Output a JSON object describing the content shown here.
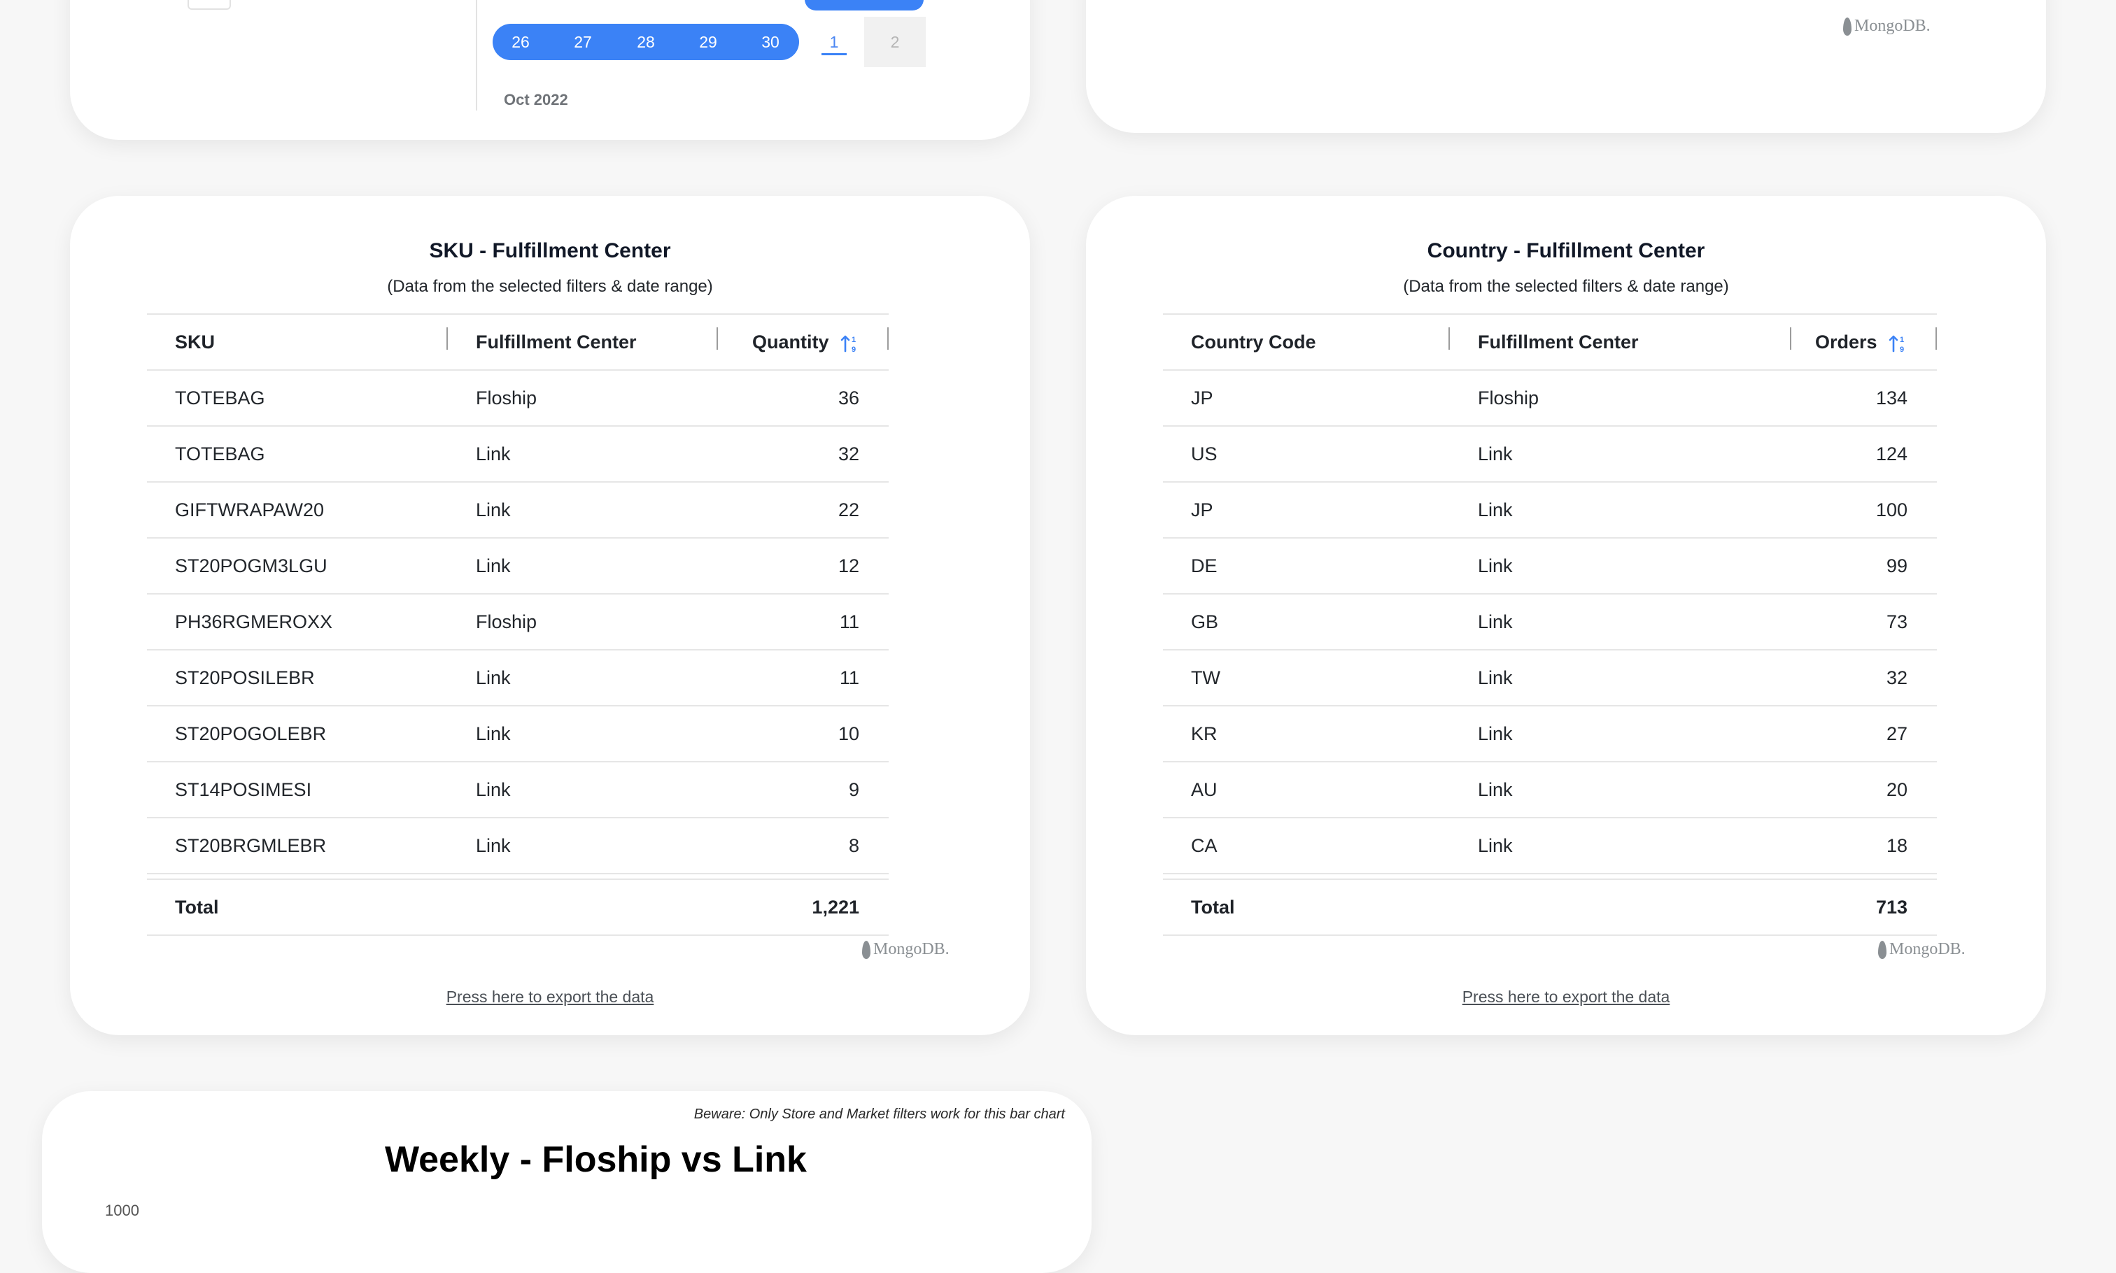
{
  "calendar": {
    "days": [
      "26",
      "27",
      "28",
      "29",
      "30"
    ],
    "next_days": [
      "1",
      "2"
    ],
    "month_label": "Oct 2022"
  },
  "brand": {
    "mongodb_label": "MongoDB."
  },
  "sku_table": {
    "title": "SKU - Fulfillment Center",
    "subtitle": "(Data from the selected filters & date range)",
    "headers": [
      "SKU",
      "Fulfillment Center",
      "Quantity"
    ],
    "rows": [
      [
        "TOTEBAG",
        "Floship",
        "36"
      ],
      [
        "TOTEBAG",
        "Link",
        "32"
      ],
      [
        "GIFTWRAPAW20",
        "Link",
        "22"
      ],
      [
        "ST20POGM3LGU",
        "Link",
        "12"
      ],
      [
        "PH36RGMEROXX",
        "Floship",
        "11"
      ],
      [
        "ST20POSILEBR",
        "Link",
        "11"
      ],
      [
        "ST20POGOLEBR",
        "Link",
        "10"
      ],
      [
        "ST14POSIMESI",
        "Link",
        "9"
      ],
      [
        "ST20BRGMLEBR",
        "Link",
        "8"
      ]
    ],
    "total_label": "Total",
    "total_value": "1,221",
    "export_label": "Press here to export the data"
  },
  "country_table": {
    "title": "Country - Fulfillment Center",
    "subtitle": "(Data from the selected filters & date range)",
    "headers": [
      "Country Code",
      "Fulfillment Center",
      "Orders"
    ],
    "rows": [
      [
        "JP",
        "Floship",
        "134"
      ],
      [
        "US",
        "Link",
        "124"
      ],
      [
        "JP",
        "Link",
        "100"
      ],
      [
        "DE",
        "Link",
        "99"
      ],
      [
        "GB",
        "Link",
        "73"
      ],
      [
        "TW",
        "Link",
        "32"
      ],
      [
        "KR",
        "Link",
        "27"
      ],
      [
        "AU",
        "Link",
        "20"
      ],
      [
        "CA",
        "Link",
        "18"
      ]
    ],
    "total_label": "Total",
    "total_value": "713",
    "export_label": "Press here to export the data"
  },
  "weekly_chart": {
    "title": "Weekly - Floship vs Link",
    "note": "Beware: Only Store and Market filters work for this bar chart",
    "axis_peek": "1000"
  },
  "colors": {
    "accent": "#3b82f6",
    "background": "#f7f7f7",
    "card": "#ffffff"
  },
  "icons": {
    "sort": "sort-ascending-icon",
    "logo": "mongodb-leaf-icon"
  }
}
